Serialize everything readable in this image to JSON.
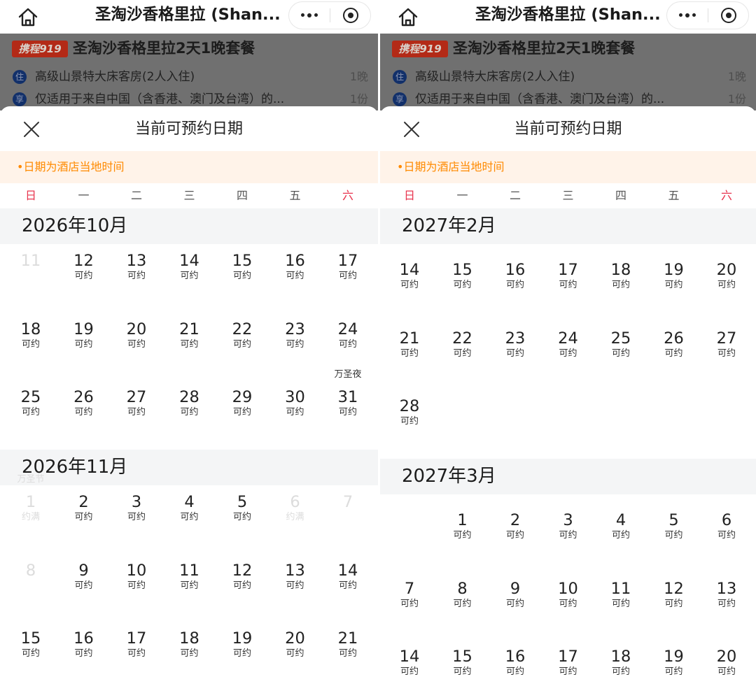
{
  "panels": [
    {
      "nav_title": "圣淘沙香格里拉 (Shan...",
      "brand_tag": "携程919",
      "package_title": "圣淘沙香格里拉2天1晚套餐",
      "items": [
        {
          "badge": "住",
          "text": "高级山景特大床客房(2人入住)",
          "qty": "1晚"
        },
        {
          "badge": "享",
          "text": "仅适用于来自中国（含香港、澳门及台湾）的...",
          "qty": "1份"
        }
      ],
      "sheet_title": "当前可预约日期",
      "notice": "•日期为酒店当地时间",
      "weekdays": [
        "日",
        "一",
        "二",
        "三",
        "四",
        "五",
        "六"
      ],
      "months": [
        {
          "title": "2026年10月",
          "weeks": [
            [
              {
                "d": "11",
                "s": "",
                "dis": true
              },
              {
                "d": "12",
                "s": "可约"
              },
              {
                "d": "13",
                "s": "可约"
              },
              {
                "d": "14",
                "s": "可约"
              },
              {
                "d": "15",
                "s": "可约"
              },
              {
                "d": "16",
                "s": "可约"
              },
              {
                "d": "17",
                "s": "可约"
              }
            ],
            [
              {
                "d": "18",
                "s": "可约"
              },
              {
                "d": "19",
                "s": "可约"
              },
              {
                "d": "20",
                "s": "可约"
              },
              {
                "d": "21",
                "s": "可约"
              },
              {
                "d": "22",
                "s": "可约"
              },
              {
                "d": "23",
                "s": "可约"
              },
              {
                "d": "24",
                "s": "可约"
              }
            ],
            [
              {
                "d": "25",
                "s": "可约"
              },
              {
                "d": "26",
                "s": "可约"
              },
              {
                "d": "27",
                "s": "可约"
              },
              {
                "d": "28",
                "s": "可约"
              },
              {
                "d": "29",
                "s": "可约"
              },
              {
                "d": "30",
                "s": "可约"
              },
              {
                "d": "31",
                "s": "可约",
                "h": "万圣夜"
              }
            ]
          ]
        },
        {
          "title": "2026年11月",
          "weeks": [
            [
              {
                "d": "1",
                "s": "约满",
                "h": "万圣节",
                "dis": true
              },
              {
                "d": "2",
                "s": "可约"
              },
              {
                "d": "3",
                "s": "可约"
              },
              {
                "d": "4",
                "s": "可约"
              },
              {
                "d": "5",
                "s": "可约"
              },
              {
                "d": "6",
                "s": "约满",
                "dis": true
              },
              {
                "d": "7",
                "s": "",
                "dis": true
              }
            ],
            [
              {
                "d": "8",
                "s": "",
                "dis": true
              },
              {
                "d": "9",
                "s": "可约"
              },
              {
                "d": "10",
                "s": "可约"
              },
              {
                "d": "11",
                "s": "可约"
              },
              {
                "d": "12",
                "s": "可约"
              },
              {
                "d": "13",
                "s": "可约"
              },
              {
                "d": "14",
                "s": "可约"
              }
            ],
            [
              {
                "d": "15",
                "s": "可约"
              },
              {
                "d": "16",
                "s": "可约"
              },
              {
                "d": "17",
                "s": "可约"
              },
              {
                "d": "18",
                "s": "可约"
              },
              {
                "d": "19",
                "s": "可约"
              },
              {
                "d": "20",
                "s": "可约"
              },
              {
                "d": "21",
                "s": "可约"
              }
            ]
          ]
        }
      ]
    },
    {
      "nav_title": "圣淘沙香格里拉 (Shan...",
      "brand_tag": "携程919",
      "package_title": "圣淘沙香格里拉2天1晚套餐",
      "items": [
        {
          "badge": "住",
          "text": "高级山景特大床客房(2人入住)",
          "qty": "1晚"
        },
        {
          "badge": "享",
          "text": "仅适用于来自中国（含香港、澳门及台湾）的...",
          "qty": "1份"
        }
      ],
      "sheet_title": "当前可预约日期",
      "notice": "•日期为酒店当地时间",
      "weekdays": [
        "日",
        "一",
        "二",
        "三",
        "四",
        "五",
        "六"
      ],
      "months": [
        {
          "title": "2027年2月",
          "weeks": [
            [
              {
                "d": "14",
                "s": "可约"
              },
              {
                "d": "15",
                "s": "可约"
              },
              {
                "d": "16",
                "s": "可约"
              },
              {
                "d": "17",
                "s": "可约"
              },
              {
                "d": "18",
                "s": "可约"
              },
              {
                "d": "19",
                "s": "可约"
              },
              {
                "d": "20",
                "s": "可约"
              }
            ],
            [
              {
                "d": "21",
                "s": "可约"
              },
              {
                "d": "22",
                "s": "可约"
              },
              {
                "d": "23",
                "s": "可约"
              },
              {
                "d": "24",
                "s": "可约"
              },
              {
                "d": "25",
                "s": "可约"
              },
              {
                "d": "26",
                "s": "可约"
              },
              {
                "d": "27",
                "s": "可约"
              }
            ],
            [
              {
                "d": "28",
                "s": "可约"
              },
              null,
              null,
              null,
              null,
              null,
              null
            ]
          ]
        },
        {
          "title": "2027年3月",
          "weeks": [
            [
              null,
              {
                "d": "1",
                "s": "可约"
              },
              {
                "d": "2",
                "s": "可约"
              },
              {
                "d": "3",
                "s": "可约"
              },
              {
                "d": "4",
                "s": "可约"
              },
              {
                "d": "5",
                "s": "可约"
              },
              {
                "d": "6",
                "s": "可约"
              }
            ],
            [
              {
                "d": "7",
                "s": "可约"
              },
              {
                "d": "8",
                "s": "可约"
              },
              {
                "d": "9",
                "s": "可约"
              },
              {
                "d": "10",
                "s": "可约"
              },
              {
                "d": "11",
                "s": "可约"
              },
              {
                "d": "12",
                "s": "可约"
              },
              {
                "d": "13",
                "s": "可约"
              }
            ],
            [
              {
                "d": "14",
                "s": "可约"
              },
              {
                "d": "15",
                "s": "可约"
              },
              {
                "d": "16",
                "s": "可约"
              },
              {
                "d": "17",
                "s": "可约"
              },
              {
                "d": "18",
                "s": "可约"
              },
              {
                "d": "19",
                "s": "可约"
              },
              {
                "d": "20",
                "s": "可约"
              }
            ]
          ]
        }
      ]
    }
  ]
}
